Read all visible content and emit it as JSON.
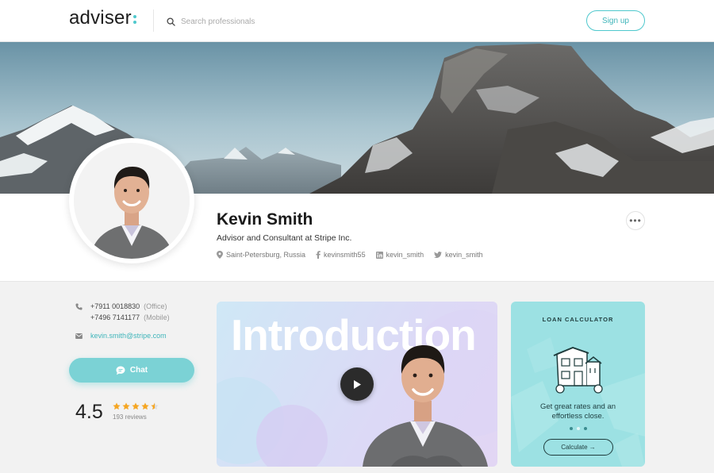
{
  "header": {
    "logo": "adviser",
    "search_placeholder": "Search professionals",
    "signup_label": "Sign up"
  },
  "profile": {
    "name": "Kevin Smith",
    "title": "Advisor and Consultant at Stripe Inc.",
    "location": "Saint-Petersburg, Russia",
    "facebook": "kevinsmith55",
    "linkedin": "kevin_smith",
    "twitter": "kevin_smith",
    "more_label": "•••"
  },
  "contact": {
    "phone_office": "+7911 0018830",
    "phone_office_tag": "(Office)",
    "phone_mobile": "+7496 7141177",
    "phone_mobile_tag": "(Mobile)",
    "email": "kevin.smith@stripe.com",
    "chat_label": "Chat"
  },
  "rating": {
    "score": "4.5",
    "stars": 4.5,
    "reviews": "193 reviews"
  },
  "video": {
    "heading": "Introduction"
  },
  "loan": {
    "title": "LOAN CALCULATOR",
    "text_line1": "Get great rates and an",
    "text_line2": "effortless close.",
    "button_label": "Calculate →"
  },
  "colors": {
    "accent": "#4fc8cd",
    "star": "#f5a623",
    "loan_bg": "#9ce1e3"
  }
}
